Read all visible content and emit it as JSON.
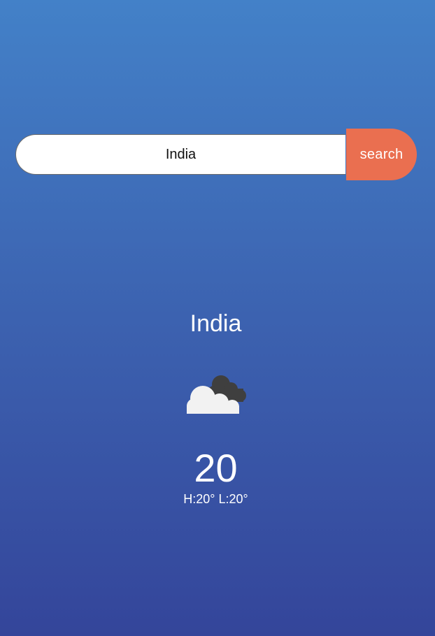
{
  "search": {
    "value": "India",
    "button_label": "search"
  },
  "weather": {
    "city": "India",
    "icon": "cloudy-icon",
    "temperature": "20",
    "high_low": "H:20° L:20°"
  },
  "colors": {
    "background_top": "#4381c8",
    "background_bottom": "#34459a",
    "search_button": "#ea6f50"
  }
}
